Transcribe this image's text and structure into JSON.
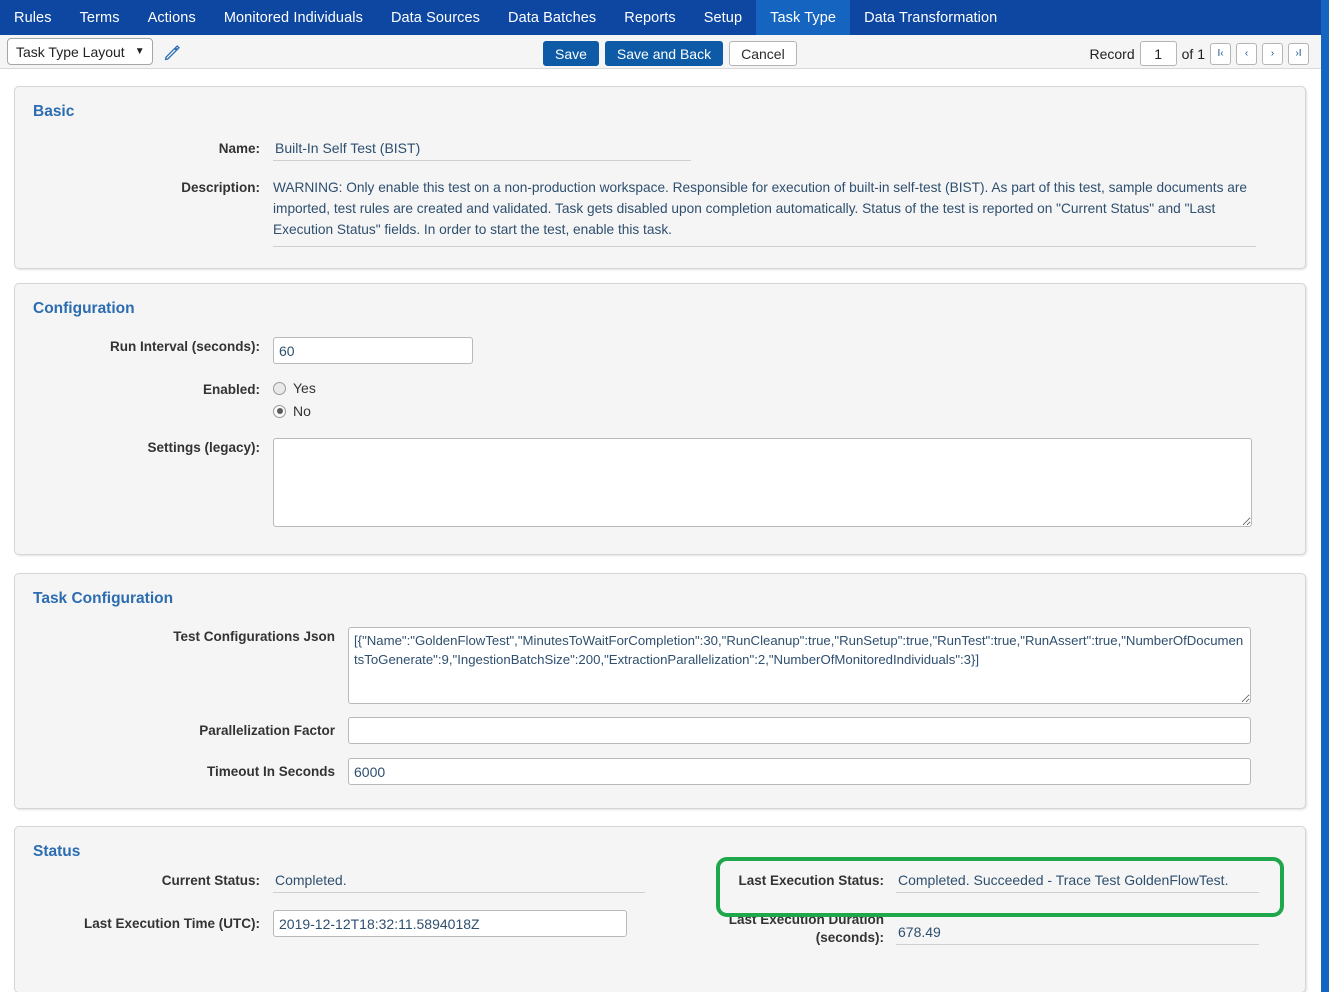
{
  "nav": {
    "items": [
      {
        "label": "Rules",
        "active": false
      },
      {
        "label": "Terms",
        "active": false
      },
      {
        "label": "Actions",
        "active": false
      },
      {
        "label": "Monitored Individuals",
        "active": false
      },
      {
        "label": "Data Sources",
        "active": false
      },
      {
        "label": "Data Batches",
        "active": false
      },
      {
        "label": "Reports",
        "active": false
      },
      {
        "label": "Setup",
        "active": false
      },
      {
        "label": "Task Type",
        "active": true
      },
      {
        "label": "Data Transformation",
        "active": false
      }
    ]
  },
  "toolbar": {
    "layout_select_value": "Task Type Layout",
    "layout_caret": "▼",
    "save_label": "Save",
    "save_and_back_label": "Save and Back",
    "cancel_label": "Cancel",
    "record_label": "Record",
    "record_value": "1",
    "of_label": "of 1",
    "pager_first": "I‹",
    "pager_prev": "‹",
    "pager_next": "›",
    "pager_last": "›I"
  },
  "basic": {
    "title": "Basic",
    "name_label": "Name:",
    "name_value": "Built-In Self Test (BIST)",
    "description_label": "Description:",
    "description_value": "WARNING: Only enable this test on a non-production workspace. Responsible for execution of built-in self-test (BIST). As part of this test, sample documents are imported, test rules are created and validated. Task gets disabled upon completion automatically. Status of the test is reported on \"Current Status\" and \"Last Execution Status\" fields. In order to start the test, enable this task."
  },
  "configuration": {
    "title": "Configuration",
    "run_interval_label": "Run Interval (seconds):",
    "run_interval_value": "60",
    "enabled_label": "Enabled:",
    "enabled_yes_label": "Yes",
    "enabled_no_label": "No",
    "enabled_selected": "No",
    "settings_label": "Settings (legacy):",
    "settings_value": ""
  },
  "task_configuration": {
    "title": "Task Configuration",
    "test_json_label": "Test Configurations Json",
    "test_json_value": "[{\"Name\":\"GoldenFlowTest\",\"MinutesToWaitForCompletion\":30,\"RunCleanup\":true,\"RunSetup\":true,\"RunTest\":true,\"RunAssert\":true,\"NumberOfDocumentsToGenerate\":9,\"IngestionBatchSize\":200,\"ExtractionParallelization\":2,\"NumberOfMonitoredIndividuals\":3}]",
    "parallelization_label": "Parallelization Factor",
    "parallelization_value": "",
    "timeout_label": "Timeout In Seconds",
    "timeout_value": "6000"
  },
  "status": {
    "title": "Status",
    "current_status_label": "Current Status:",
    "current_status_value": "Completed.",
    "last_exec_time_label": "Last Execution Time (UTC):",
    "last_exec_time_value": "2019-12-12T18:32:11.5894018Z",
    "last_exec_status_label": "Last Execution Status:",
    "last_exec_status_value": "Completed. Succeeded - Trace Test GoldenFlowTest.",
    "last_exec_duration_label_line1": "Last Execution Duration",
    "last_exec_duration_label_line2": "(seconds):",
    "last_exec_duration_value": "678.49"
  },
  "colors": {
    "nav_bg": "#0d47a1",
    "nav_active_bg": "#1565c0",
    "accent_blue": "#2c6cb0",
    "primary_button": "#0d5ba6",
    "highlight_green": "#1fa74b",
    "panel_bg": "#f5f5f5",
    "value_text": "#2f4f6f"
  }
}
